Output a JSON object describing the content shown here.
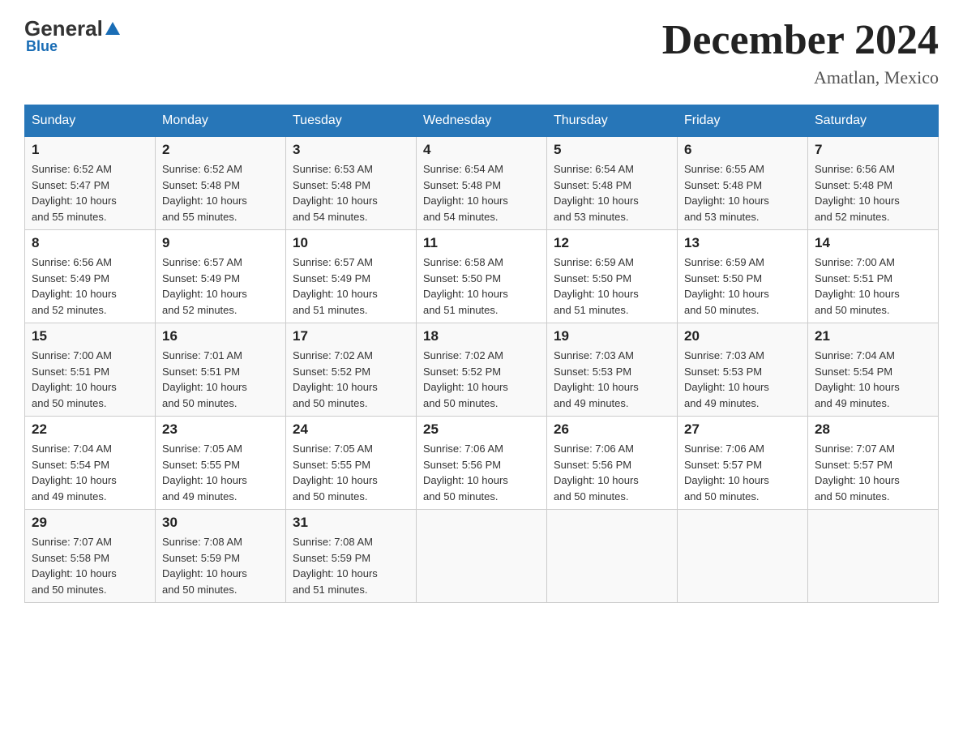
{
  "header": {
    "logo": {
      "general": "General",
      "blue": "Blue"
    },
    "title": "December 2024",
    "subtitle": "Amatlan, Mexico"
  },
  "days_of_week": [
    "Sunday",
    "Monday",
    "Tuesday",
    "Wednesday",
    "Thursday",
    "Friday",
    "Saturday"
  ],
  "weeks": [
    [
      {
        "day": "1",
        "sunrise": "6:52 AM",
        "sunset": "5:47 PM",
        "daylight": "10 hours and 55 minutes."
      },
      {
        "day": "2",
        "sunrise": "6:52 AM",
        "sunset": "5:48 PM",
        "daylight": "10 hours and 55 minutes."
      },
      {
        "day": "3",
        "sunrise": "6:53 AM",
        "sunset": "5:48 PM",
        "daylight": "10 hours and 54 minutes."
      },
      {
        "day": "4",
        "sunrise": "6:54 AM",
        "sunset": "5:48 PM",
        "daylight": "10 hours and 54 minutes."
      },
      {
        "day": "5",
        "sunrise": "6:54 AM",
        "sunset": "5:48 PM",
        "daylight": "10 hours and 53 minutes."
      },
      {
        "day": "6",
        "sunrise": "6:55 AM",
        "sunset": "5:48 PM",
        "daylight": "10 hours and 53 minutes."
      },
      {
        "day": "7",
        "sunrise": "6:56 AM",
        "sunset": "5:48 PM",
        "daylight": "10 hours and 52 minutes."
      }
    ],
    [
      {
        "day": "8",
        "sunrise": "6:56 AM",
        "sunset": "5:49 PM",
        "daylight": "10 hours and 52 minutes."
      },
      {
        "day": "9",
        "sunrise": "6:57 AM",
        "sunset": "5:49 PM",
        "daylight": "10 hours and 52 minutes."
      },
      {
        "day": "10",
        "sunrise": "6:57 AM",
        "sunset": "5:49 PM",
        "daylight": "10 hours and 51 minutes."
      },
      {
        "day": "11",
        "sunrise": "6:58 AM",
        "sunset": "5:50 PM",
        "daylight": "10 hours and 51 minutes."
      },
      {
        "day": "12",
        "sunrise": "6:59 AM",
        "sunset": "5:50 PM",
        "daylight": "10 hours and 51 minutes."
      },
      {
        "day": "13",
        "sunrise": "6:59 AM",
        "sunset": "5:50 PM",
        "daylight": "10 hours and 50 minutes."
      },
      {
        "day": "14",
        "sunrise": "7:00 AM",
        "sunset": "5:51 PM",
        "daylight": "10 hours and 50 minutes."
      }
    ],
    [
      {
        "day": "15",
        "sunrise": "7:00 AM",
        "sunset": "5:51 PM",
        "daylight": "10 hours and 50 minutes."
      },
      {
        "day": "16",
        "sunrise": "7:01 AM",
        "sunset": "5:51 PM",
        "daylight": "10 hours and 50 minutes."
      },
      {
        "day": "17",
        "sunrise": "7:02 AM",
        "sunset": "5:52 PM",
        "daylight": "10 hours and 50 minutes."
      },
      {
        "day": "18",
        "sunrise": "7:02 AM",
        "sunset": "5:52 PM",
        "daylight": "10 hours and 50 minutes."
      },
      {
        "day": "19",
        "sunrise": "7:03 AM",
        "sunset": "5:53 PM",
        "daylight": "10 hours and 49 minutes."
      },
      {
        "day": "20",
        "sunrise": "7:03 AM",
        "sunset": "5:53 PM",
        "daylight": "10 hours and 49 minutes."
      },
      {
        "day": "21",
        "sunrise": "7:04 AM",
        "sunset": "5:54 PM",
        "daylight": "10 hours and 49 minutes."
      }
    ],
    [
      {
        "day": "22",
        "sunrise": "7:04 AM",
        "sunset": "5:54 PM",
        "daylight": "10 hours and 49 minutes."
      },
      {
        "day": "23",
        "sunrise": "7:05 AM",
        "sunset": "5:55 PM",
        "daylight": "10 hours and 49 minutes."
      },
      {
        "day": "24",
        "sunrise": "7:05 AM",
        "sunset": "5:55 PM",
        "daylight": "10 hours and 50 minutes."
      },
      {
        "day": "25",
        "sunrise": "7:06 AM",
        "sunset": "5:56 PM",
        "daylight": "10 hours and 50 minutes."
      },
      {
        "day": "26",
        "sunrise": "7:06 AM",
        "sunset": "5:56 PM",
        "daylight": "10 hours and 50 minutes."
      },
      {
        "day": "27",
        "sunrise": "7:06 AM",
        "sunset": "5:57 PM",
        "daylight": "10 hours and 50 minutes."
      },
      {
        "day": "28",
        "sunrise": "7:07 AM",
        "sunset": "5:57 PM",
        "daylight": "10 hours and 50 minutes."
      }
    ],
    [
      {
        "day": "29",
        "sunrise": "7:07 AM",
        "sunset": "5:58 PM",
        "daylight": "10 hours and 50 minutes."
      },
      {
        "day": "30",
        "sunrise": "7:08 AM",
        "sunset": "5:59 PM",
        "daylight": "10 hours and 50 minutes."
      },
      {
        "day": "31",
        "sunrise": "7:08 AM",
        "sunset": "5:59 PM",
        "daylight": "10 hours and 51 minutes."
      },
      null,
      null,
      null,
      null
    ]
  ],
  "labels": {
    "sunrise": "Sunrise:",
    "sunset": "Sunset:",
    "daylight": "Daylight:"
  }
}
